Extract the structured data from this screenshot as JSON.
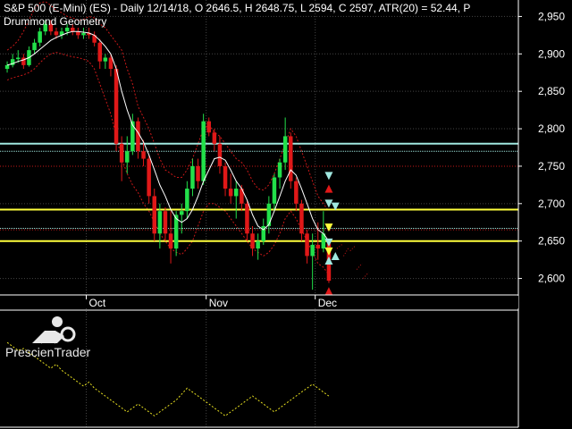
{
  "header": {
    "line1": "S&P 500 (E-Mini) (ES) - Daily 12/14/18, O 2646.5, H 2648.75, L 2594, C 2597, ATR(20) = 52.44, P",
    "line2": "Drummond Geometry"
  },
  "brand": {
    "name": "PrescienTrader",
    "icon": "prescientrader-logo-icon"
  },
  "colors": {
    "background": "#000000",
    "up": "#22e04a",
    "down": "#e01818",
    "ma": "#ffffff",
    "envelope": "#c81818",
    "support_resistance": "#ffff3c",
    "pl_lines": "#a0e8e0",
    "osc": "#e8e020",
    "grid": "#444444"
  },
  "chart_data": [
    {
      "type": "candlestick",
      "title": "",
      "x_labels": [
        "Oct",
        "Nov",
        "Dec"
      ],
      "y_ticks": [
        "2,950",
        "2,900",
        "2,850",
        "2,800",
        "2,750",
        "2,700",
        "2,650",
        "2,600"
      ],
      "y_tick_values": [
        2950,
        2900,
        2850,
        2800,
        2750,
        2700,
        2650,
        2600
      ],
      "ylim": [
        2578,
        2972
      ],
      "grid": true,
      "candles": [
        [
          2880,
          2890,
          2875,
          2885
        ],
        [
          2885,
          2900,
          2882,
          2893
        ],
        [
          2893,
          2905,
          2888,
          2895
        ],
        [
          2895,
          2900,
          2880,
          2885
        ],
        [
          2885,
          2910,
          2883,
          2905
        ],
        [
          2905,
          2920,
          2900,
          2915
        ],
        [
          2915,
          2935,
          2910,
          2930
        ],
        [
          2930,
          2945,
          2925,
          2940
        ],
        [
          2940,
          2945,
          2925,
          2930
        ],
        [
          2930,
          2935,
          2920,
          2925
        ],
        [
          2925,
          2935,
          2920,
          2930
        ],
        [
          2930,
          2940,
          2925,
          2935
        ],
        [
          2935,
          2940,
          2925,
          2930
        ],
        [
          2930,
          2935,
          2920,
          2925
        ],
        [
          2925,
          2935,
          2920,
          2928
        ],
        [
          2928,
          2935,
          2920,
          2925
        ],
        [
          2925,
          2930,
          2910,
          2915
        ],
        [
          2915,
          2920,
          2880,
          2890
        ],
        [
          2890,
          2900,
          2880,
          2895
        ],
        [
          2895,
          2900,
          2870,
          2880
        ],
        [
          2880,
          2885,
          2770,
          2780
        ],
        [
          2780,
          2790,
          2730,
          2755
        ],
        [
          2755,
          2790,
          2740,
          2770
        ],
        [
          2770,
          2820,
          2765,
          2810
        ],
        [
          2810,
          2815,
          2760,
          2770
        ],
        [
          2770,
          2785,
          2750,
          2760
        ],
        [
          2760,
          2765,
          2700,
          2710
        ],
        [
          2710,
          2720,
          2650,
          2660
        ],
        [
          2660,
          2700,
          2640,
          2690
        ],
        [
          2690,
          2695,
          2650,
          2660
        ],
        [
          2660,
          2690,
          2620,
          2640
        ],
        [
          2640,
          2690,
          2630,
          2685
        ],
        [
          2685,
          2700,
          2660,
          2690
        ],
        [
          2690,
          2730,
          2680,
          2720
        ],
        [
          2720,
          2760,
          2710,
          2750
        ],
        [
          2750,
          2760,
          2720,
          2730
        ],
        [
          2730,
          2820,
          2725,
          2810
        ],
        [
          2810,
          2815,
          2790,
          2795
        ],
        [
          2795,
          2800,
          2770,
          2780
        ],
        [
          2780,
          2790,
          2740,
          2750
        ],
        [
          2750,
          2755,
          2710,
          2720
        ],
        [
          2720,
          2740,
          2700,
          2710
        ],
        [
          2710,
          2730,
          2680,
          2720
        ],
        [
          2720,
          2725,
          2690,
          2700
        ],
        [
          2700,
          2705,
          2650,
          2660
        ],
        [
          2660,
          2670,
          2630,
          2640
        ],
        [
          2640,
          2660,
          2625,
          2650
        ],
        [
          2650,
          2680,
          2645,
          2670
        ],
        [
          2670,
          2710,
          2660,
          2700
        ],
        [
          2700,
          2740,
          2690,
          2735
        ],
        [
          2735,
          2760,
          2720,
          2755
        ],
        [
          2755,
          2815,
          2745,
          2790
        ],
        [
          2790,
          2795,
          2720,
          2730
        ],
        [
          2730,
          2735,
          2690,
          2700
        ],
        [
          2700,
          2705,
          2650,
          2660
        ],
        [
          2660,
          2665,
          2620,
          2630
        ],
        [
          2630,
          2660,
          2585,
          2645
        ],
        [
          2645,
          2675,
          2625,
          2640
        ],
        [
          2640,
          2690,
          2635,
          2660
        ],
        [
          2646.5,
          2648.75,
          2594,
          2597
        ]
      ],
      "moving_average": [
        2885,
        2887,
        2890,
        2892,
        2895,
        2900,
        2906,
        2912,
        2918,
        2922,
        2925,
        2928,
        2930,
        2930,
        2929,
        2928,
        2925,
        2918,
        2910,
        2900,
        2880,
        2850,
        2825,
        2805,
        2795,
        2782,
        2765,
        2745,
        2725,
        2710,
        2692,
        2680,
        2675,
        2680,
        2692,
        2710,
        2730,
        2745,
        2760,
        2762,
        2758,
        2745,
        2730,
        2720,
        2705,
        2685,
        2670,
        2665,
        2672,
        2690,
        2710,
        2730,
        2745,
        2738,
        2720,
        2700,
        2680,
        2665,
        2660,
        2650
      ],
      "envelope_upper": [
        2905,
        2910,
        2918,
        2930,
        2945,
        2960,
        2968,
        2970,
        2965,
        2958,
        2955,
        2950,
        2948,
        2945,
        2946,
        2950,
        2948,
        2940,
        2935,
        2925,
        2915,
        2905,
        2880,
        2860,
        2830,
        2815,
        2800,
        2780,
        2760,
        2745,
        2740,
        2735,
        2735,
        2745,
        2760,
        2780,
        2800,
        2805,
        2795,
        2790,
        2780,
        2770,
        2760,
        2755,
        2745,
        2730,
        2720,
        2718,
        2725,
        2740,
        2760,
        2780,
        2800,
        2790,
        2770,
        2750,
        2730,
        2710,
        2700,
        2690
      ],
      "envelope_lower": [
        2865,
        2868,
        2870,
        2872,
        2875,
        2880,
        2888,
        2895,
        2900,
        2902,
        2900,
        2898,
        2896,
        2895,
        2893,
        2890,
        2880,
        2860,
        2840,
        2820,
        2790,
        2760,
        2740,
        2725,
        2715,
        2700,
        2690,
        2675,
        2660,
        2650,
        2640,
        2635,
        2632,
        2640,
        2650,
        2670,
        2690,
        2700,
        2700,
        2695,
        2690,
        2680,
        2670,
        2660,
        2650,
        2640,
        2635,
        2630,
        2635,
        2645,
        2660,
        2680,
        2690,
        2680,
        2665,
        2650,
        2635,
        2620,
        2615,
        2605
      ],
      "support_resistance": [
        2692,
        2650
      ],
      "pl_lines": [
        2780,
        2770,
        2667
      ],
      "dotted_red_levels": [
        2750,
        2665
      ],
      "projection_dots": [
        [
          2640,
          2646
        ],
        [
          2630,
          2642
        ],
        [
          2637,
          2644
        ],
        [
          2612,
          2620
        ],
        [
          2600,
          2608
        ]
      ],
      "arrows": [
        {
          "bar": 59.5,
          "price": 2737,
          "kind": "down",
          "color": "#a0e8e0"
        },
        {
          "bar": 59.5,
          "price": 2720,
          "kind": "up",
          "color": "#e01818"
        },
        {
          "bar": 59.5,
          "price": 2700,
          "kind": "down",
          "color": "#a0e8e0"
        },
        {
          "bar": 59.5,
          "price": 2668,
          "kind": "down",
          "color": "#ffff3c"
        },
        {
          "bar": 59.5,
          "price": 2648,
          "kind": "down",
          "color": "#a0e8e0"
        },
        {
          "bar": 59.5,
          "price": 2636,
          "kind": "down",
          "color": "#ffff3c"
        },
        {
          "bar": 59.5,
          "price": 2624,
          "kind": "up",
          "color": "#a0e8e0"
        },
        {
          "bar": 59.5,
          "price": 2583,
          "kind": "up",
          "color": "#e01818"
        },
        {
          "bar": 60.7,
          "price": 2696,
          "kind": "down",
          "color": "#a0e8e0"
        },
        {
          "bar": 60.7,
          "price": 2630,
          "kind": "up",
          "color": "#a0e8e0"
        }
      ]
    },
    {
      "type": "line",
      "title": "",
      "ylim": [
        0,
        1
      ],
      "series": [
        {
          "values": [
            0.8,
            0.76,
            0.72,
            0.74,
            0.7,
            0.66,
            0.62,
            0.58,
            0.54,
            0.58,
            0.52,
            0.48,
            0.44,
            0.4,
            0.36,
            0.4,
            0.34,
            0.3,
            0.26,
            0.22,
            0.18,
            0.14,
            0.1,
            0.14,
            0.18,
            0.14,
            0.1,
            0.06,
            0.1,
            0.14,
            0.18,
            0.22,
            0.28,
            0.34,
            0.3,
            0.26,
            0.22,
            0.18,
            0.14,
            0.1,
            0.06,
            0.1,
            0.14,
            0.18,
            0.22,
            0.26,
            0.22,
            0.18,
            0.14,
            0.1,
            0.14,
            0.18,
            0.22,
            0.26,
            0.3,
            0.34,
            0.38,
            0.34,
            0.3,
            0.26
          ]
        }
      ]
    }
  ]
}
